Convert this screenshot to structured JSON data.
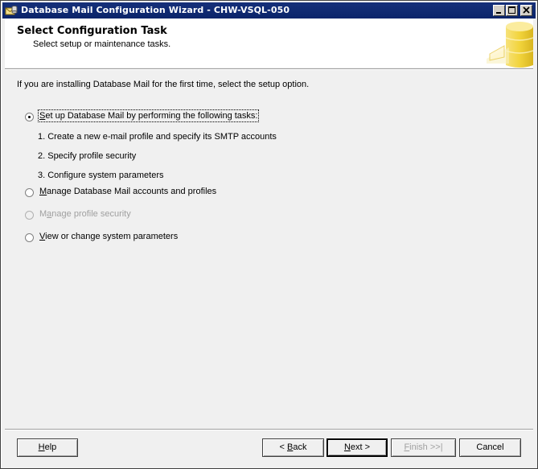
{
  "window": {
    "title": "Database Mail Configuration Wizard - CHW-VSQL-050"
  },
  "header": {
    "title": "Select Configuration Task",
    "subtitle": "Select setup or maintenance tasks."
  },
  "body": {
    "intro": "If you are installing Database Mail for the first time, select the setup option.",
    "options": {
      "setup": {
        "key": "S",
        "rest": "et up Database Mail by performing the following tasks:",
        "checked": true,
        "enabled": true
      },
      "manage_accounts": {
        "key": "M",
        "rest": "anage Database Mail accounts and profiles",
        "checked": false,
        "enabled": true
      },
      "manage_security": {
        "key": "a",
        "pre": "M",
        "rest": "nage profile security",
        "checked": false,
        "enabled": false
      },
      "system_params": {
        "key": "V",
        "rest": "iew or change system parameters",
        "checked": false,
        "enabled": true
      }
    },
    "steps": [
      "1. Create a new e-mail profile and specify its SMTP accounts",
      "2. Specify profile security",
      "3. Configure system parameters"
    ]
  },
  "buttons": {
    "help": {
      "key": "H",
      "rest": "elp"
    },
    "back": {
      "pre": "< ",
      "key": "B",
      "rest": "ack"
    },
    "next": {
      "key": "N",
      "rest": "ext >"
    },
    "finish": {
      "key": "F",
      "rest": "inish >>|"
    },
    "cancel": {
      "label": "Cancel"
    }
  },
  "colors": {
    "titlebar": "#0a246a",
    "face": "#f0f0f0",
    "disabled_text": "#a0a0a0",
    "graphic_yellow": "#f2d43c"
  },
  "icons": {
    "app": "database-mail-icon",
    "header": "database-cylinder-icon"
  }
}
